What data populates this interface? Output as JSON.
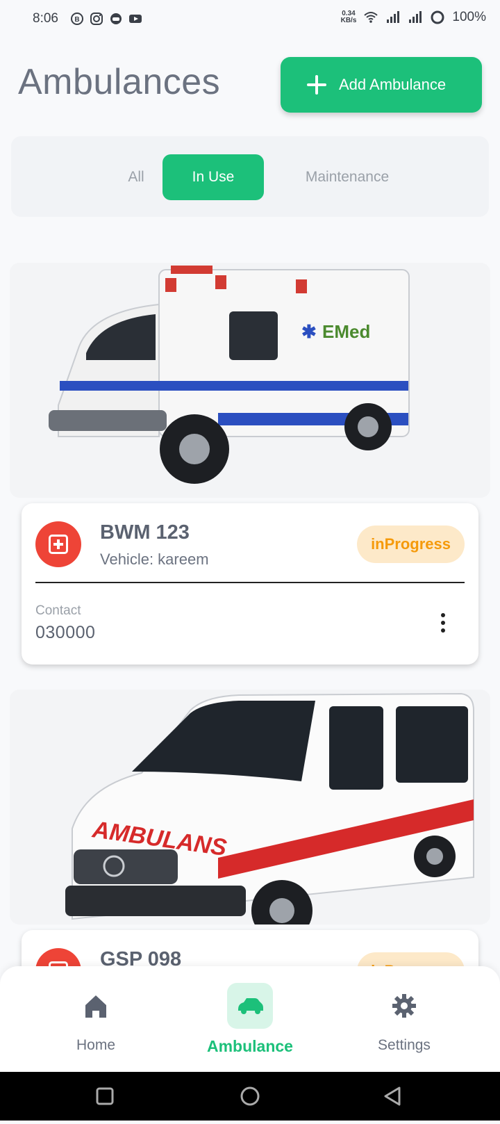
{
  "status_bar": {
    "time": "8:06",
    "net_speed_value": "0.34",
    "net_speed_unit": "KB/s",
    "battery": "100%"
  },
  "header": {
    "title": "Ambulances",
    "add_button": "Add Ambulance"
  },
  "tabs": [
    {
      "label": "All",
      "active": false
    },
    {
      "label": "In Use",
      "active": true
    },
    {
      "label": "Maintenance",
      "active": false
    }
  ],
  "ambulances": [
    {
      "plate": "BWM 123",
      "vehicle": "Vehicle: kareem",
      "status": "inProgress",
      "contact_label": "Contact",
      "contact": "030000"
    },
    {
      "plate": "GSP 098",
      "status": "inProgress"
    }
  ],
  "bottom_nav": [
    {
      "label": "Home",
      "icon": "home-icon",
      "active": false
    },
    {
      "label": "Ambulance",
      "icon": "car-icon",
      "active": true
    },
    {
      "label": "Settings",
      "icon": "gear-icon",
      "active": false
    }
  ],
  "colors": {
    "accent": "#1cc07a",
    "danger": "#ee4437",
    "status_bg": "#fde9c9",
    "status_text": "#f59a0b"
  }
}
